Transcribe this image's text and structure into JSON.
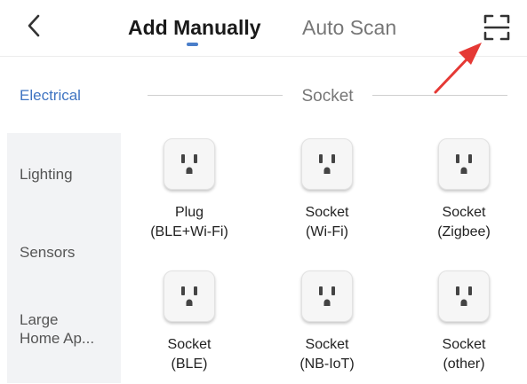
{
  "header": {
    "tabs": [
      {
        "label": "Add Manually",
        "active": true
      },
      {
        "label": "Auto Scan",
        "active": false
      }
    ],
    "back_icon": "chevron-left-icon",
    "scan_icon": "qr-scan-icon",
    "accent_color": "#4a7ec9",
    "annotation_color": "#e53935"
  },
  "sidebar": {
    "items": [
      {
        "label": "Electrical",
        "active": true
      },
      {
        "label": "Lighting",
        "active": false
      },
      {
        "label": "Sensors",
        "active": false
      },
      {
        "label_line1": "Large",
        "label_line2": "Home Ap...",
        "active": false
      }
    ]
  },
  "section": {
    "title": "Socket"
  },
  "devices": [
    {
      "name": "Plug",
      "protocol": "(BLE+Wi-Fi)",
      "icon": "outlet-icon"
    },
    {
      "name": "Socket",
      "protocol": "(Wi-Fi)",
      "icon": "outlet-icon"
    },
    {
      "name": "Socket",
      "protocol": "(Zigbee)",
      "icon": "outlet-icon"
    },
    {
      "name": "Socket",
      "protocol": "(BLE)",
      "icon": "outlet-icon"
    },
    {
      "name": "Socket",
      "protocol": "(NB-IoT)",
      "icon": "outlet-icon"
    },
    {
      "name": "Socket",
      "protocol": "(other)",
      "icon": "outlet-icon"
    }
  ]
}
